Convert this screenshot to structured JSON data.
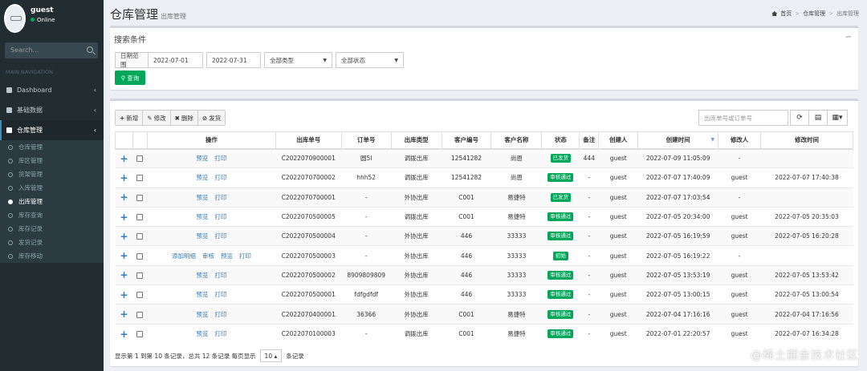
{
  "user": {
    "name": "guest",
    "status": "Online"
  },
  "sidebar": {
    "search_placeholder": "Search...",
    "nav_header": "MAIN NAVIGATION",
    "items": [
      {
        "label": "Dashboard",
        "icon": "dashboard-icon"
      },
      {
        "label": "基础数据",
        "icon": "book-icon"
      },
      {
        "label": "仓库管理",
        "icon": "warehouse-icon",
        "active": true
      }
    ],
    "subitems": [
      "仓库管理",
      "库区管理",
      "货架管理",
      "入库管理",
      "出库管理",
      "库存查询",
      "库存记录",
      "发货记录",
      "库存移动"
    ],
    "active_subitem": "出库管理"
  },
  "header": {
    "title": "仓库管理",
    "subtitle": "出库管理"
  },
  "breadcrumb": [
    "首页",
    "仓库管理",
    "出库管理"
  ],
  "search_panel": {
    "title": "搜索条件",
    "collapse": "−",
    "date_label": "日期范围",
    "date_from": "2022-07-01",
    "date_to": "2022-07-31",
    "type_select": "全部类型",
    "status_select": "全部状态",
    "query_button": "查询"
  },
  "toolbar": {
    "add": "新增",
    "edit": "修改",
    "delete": "删除",
    "ship": "发货",
    "search_placeholder": "出库单号或订单号"
  },
  "table": {
    "columns": [
      "",
      "",
      "操作",
      "出库单号",
      "订单号",
      "出库类型",
      "客户编号",
      "客户名称",
      "状态",
      "备注",
      "创建人",
      "创建时间",
      "修改人",
      "修改时间"
    ],
    "rows": [
      {
        "actions": [
          "预览",
          "打印"
        ],
        "out_no": "C2022070900001",
        "order_no": "圆5l",
        "type": "调拨出库",
        "cust_no": "12541282",
        "cust_name": "尚恩",
        "status": "已发货",
        "status_color": "#00a65a",
        "remark": "444",
        "creator": "guest",
        "created": "2022-07-09 11:05:09",
        "modifier": "-",
        "modified": ""
      },
      {
        "actions": [
          "预览",
          "打印"
        ],
        "out_no": "C2022070700002",
        "order_no": "hhh52",
        "type": "调拨出库",
        "cust_no": "12541282",
        "cust_name": "尚恩",
        "status": "审核通过",
        "status_color": "#00a65a",
        "remark": "-",
        "creator": "guest",
        "created": "2022-07-07 17:40:09",
        "modifier": "guest",
        "modified": "2022-07-07 17:40:38"
      },
      {
        "actions": [
          "预览",
          "打印"
        ],
        "out_no": "C2022070700001",
        "order_no": "-",
        "type": "外协出库",
        "cust_no": "C001",
        "cust_name": "易捷特",
        "status": "已发货",
        "status_color": "#00a65a",
        "remark": "-",
        "creator": "guest",
        "created": "2022-07-07 17:03:54",
        "modifier": "-",
        "modified": ""
      },
      {
        "actions": [
          "预览",
          "打印"
        ],
        "out_no": "C2022070500005",
        "order_no": "-",
        "type": "调拨出库",
        "cust_no": "C001",
        "cust_name": "易捷特",
        "status": "审核通过",
        "status_color": "#00a65a",
        "remark": "-",
        "creator": "guest",
        "created": "2022-07-05 20:34:00",
        "modifier": "guest",
        "modified": "2022-07-05 20:35:03"
      },
      {
        "actions": [
          "预览",
          "打印"
        ],
        "out_no": "C2022070500004",
        "order_no": "-",
        "type": "外协出库",
        "cust_no": "446",
        "cust_name": "33333",
        "status": "审核通过",
        "status_color": "#00a65a",
        "remark": "-",
        "creator": "guest",
        "created": "2022-07-05 16:19:59",
        "modifier": "guest",
        "modified": "2022-07-05 16:20:28"
      },
      {
        "actions": [
          "添加明细",
          "审核",
          "预览",
          "打印"
        ],
        "out_no": "C2022070500003",
        "order_no": "-",
        "type": "外协出库",
        "cust_no": "446",
        "cust_name": "33333",
        "status": "初始",
        "status_color": "#00a65a",
        "remark": "-",
        "creator": "guest",
        "created": "2022-07-05 16:19:22",
        "modifier": "-",
        "modified": ""
      },
      {
        "actions": [
          "预览",
          "打印"
        ],
        "out_no": "C2022070500002",
        "order_no": "8909809809",
        "type": "外协出库",
        "cust_no": "446",
        "cust_name": "33333",
        "status": "审核通过",
        "status_color": "#00a65a",
        "remark": "-",
        "creator": "guest",
        "created": "2022-07-05 13:53:19",
        "modifier": "guest",
        "modified": "2022-07-05 13:53:42"
      },
      {
        "actions": [
          "预览",
          "打印"
        ],
        "out_no": "C2022070500001",
        "order_no": "fdfgdfdf",
        "type": "外协出库",
        "cust_no": "446",
        "cust_name": "33333",
        "status": "审核通过",
        "status_color": "#00a65a",
        "remark": "-",
        "creator": "guest",
        "created": "2022-07-05 13:00:15",
        "modifier": "guest",
        "modified": "2022-07-05 13:00:54"
      },
      {
        "actions": [
          "预览",
          "打印"
        ],
        "out_no": "C2022070400001",
        "order_no": "36366",
        "type": "外协出库",
        "cust_no": "C001",
        "cust_name": "易捷特",
        "status": "审核通过",
        "status_color": "#00a65a",
        "remark": "-",
        "creator": "guest",
        "created": "2022-07-04 17:16:16",
        "modifier": "guest",
        "modified": "2022-07-04 17:16:56"
      },
      {
        "actions": [
          "预览",
          "打印"
        ],
        "out_no": "C2022070100003",
        "order_no": "-",
        "type": "调拨出库",
        "cust_no": "C001",
        "cust_name": "易捷特",
        "status": "审核通过",
        "status_color": "#00a65a",
        "remark": "-",
        "creator": "guest",
        "created": "2022-07-01 22:20:57",
        "modifier": "guest",
        "modified": "2022-07-07 16:34:28"
      }
    ]
  },
  "pagination": {
    "text_before": "显示第 1 到第 10 条记录，总共 12 条记录 每页显示",
    "page_size": "10",
    "text_after": "条记录"
  },
  "watermark": "@稀土掘金技术社区"
}
